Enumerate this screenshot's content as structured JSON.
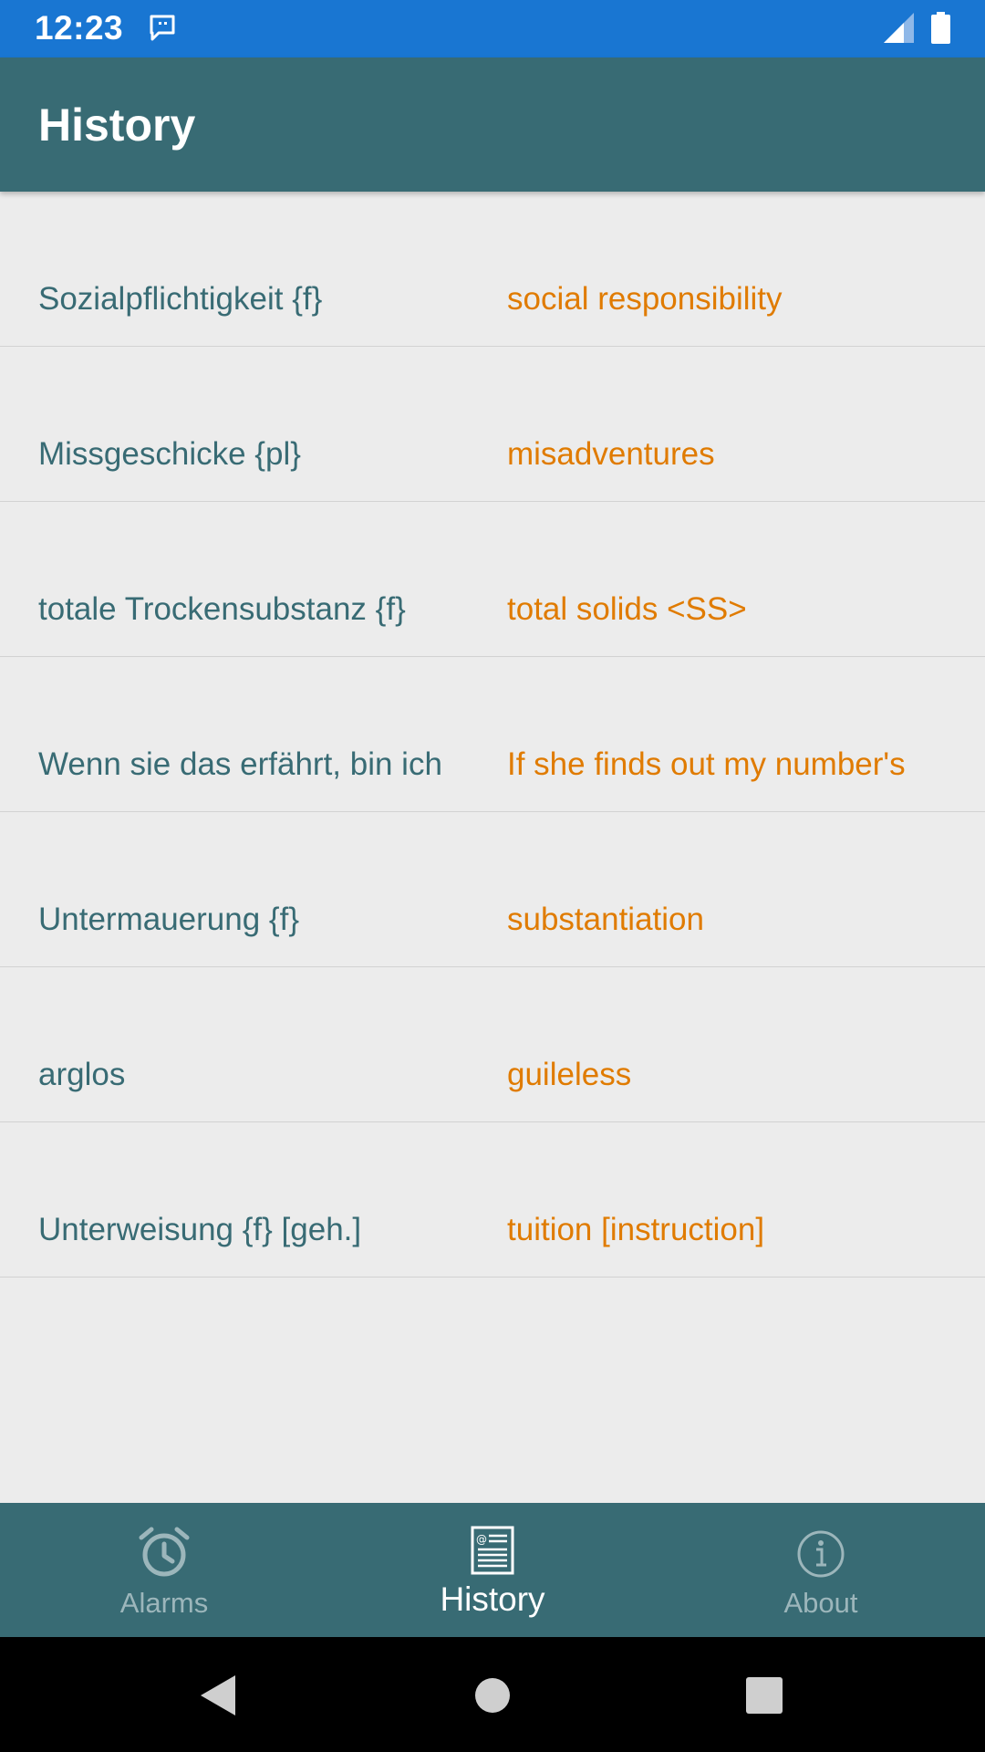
{
  "status_bar": {
    "time": "12:23",
    "icons": [
      "message-notification-icon",
      "signal-icon",
      "battery-icon"
    ],
    "color": "#1976d2"
  },
  "app_bar": {
    "title": "History",
    "color": "#386b74"
  },
  "history": {
    "items": [
      {
        "source": "Sozialpflichtigkeit {f}",
        "target": "social responsibility"
      },
      {
        "source": "Missgeschicke {pl}",
        "target": "misadventures"
      },
      {
        "source": "totale Trockensubstanz {f}",
        "target": "total solids <SS>"
      },
      {
        "source": "Wenn sie das erfährt, bin ich",
        "target": "If she finds out my number's"
      },
      {
        "source": "Untermauerung {f}",
        "target": "substantiation"
      },
      {
        "source": "arglos",
        "target": "guileless"
      },
      {
        "source": "Unterweisung {f} [geh.]",
        "target": "tuition [instruction]"
      }
    ],
    "source_color": "#386b74",
    "target_color": "#e07b00"
  },
  "bottom_nav": {
    "items": [
      {
        "label": "Alarms",
        "icon": "alarm-clock-icon",
        "active": false
      },
      {
        "label": "History",
        "icon": "history-list-icon",
        "active": true
      },
      {
        "label": "About",
        "icon": "info-icon",
        "active": false
      }
    ]
  },
  "system_nav": {
    "icons": [
      "back-icon",
      "home-icon",
      "recents-icon"
    ]
  }
}
